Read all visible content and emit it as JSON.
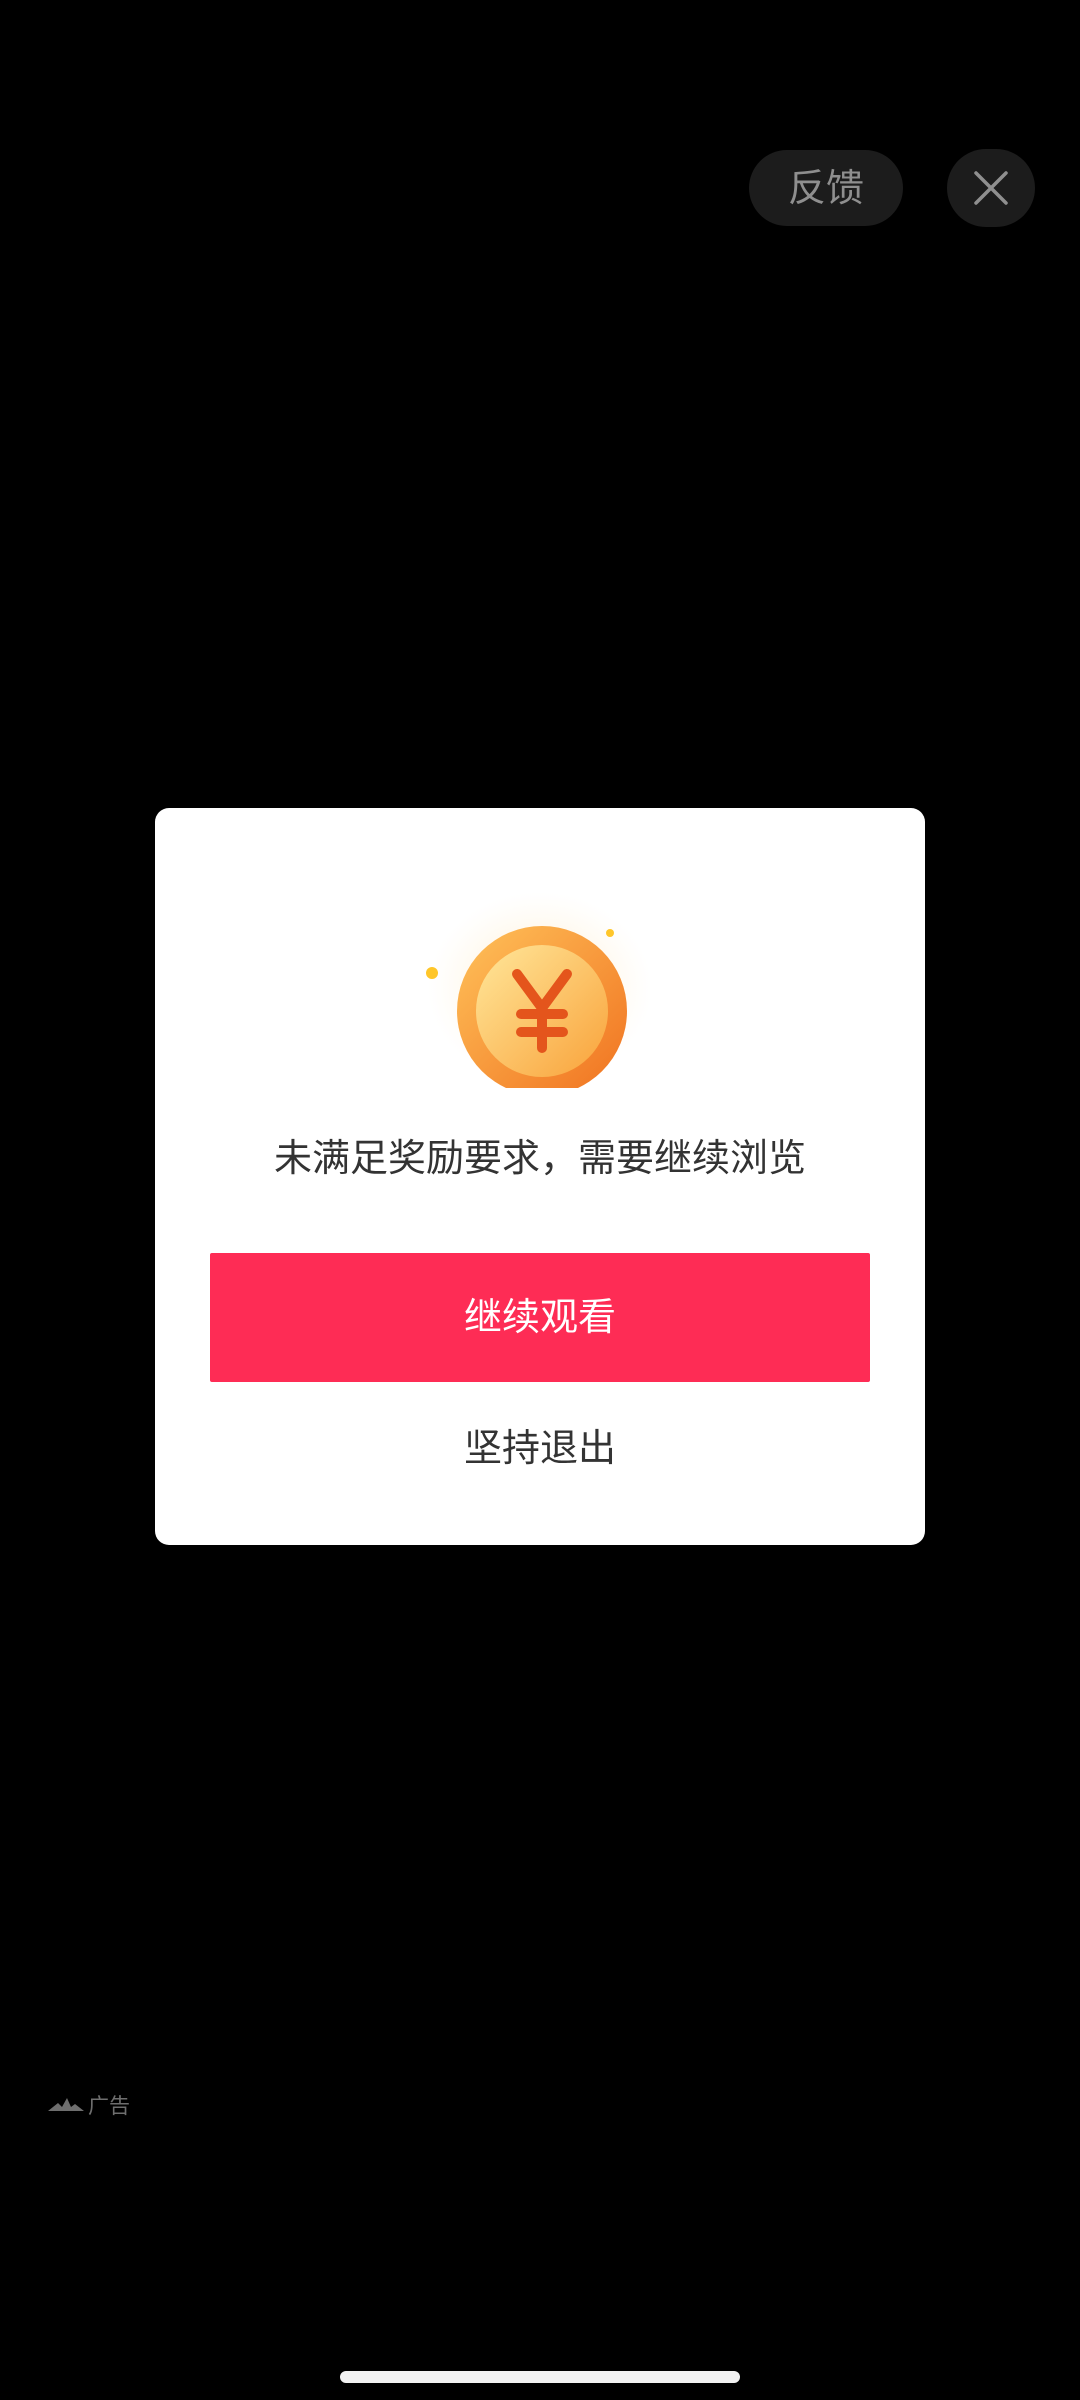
{
  "top_bar": {
    "feedback_label": "反馈",
    "close_icon": "close-icon"
  },
  "dialog": {
    "icon": "yuan-coin-icon",
    "message": "未满足奖励要求，需要继续浏览",
    "primary_label": "继续观看",
    "secondary_label": "坚持退出"
  },
  "ad_tag": {
    "icon": "ad-logo-icon",
    "label": "广告"
  },
  "colors": {
    "background": "#000000",
    "accent": "#fe2c55",
    "dialog_background": "#ffffff",
    "coin_orange": "#f7892a"
  }
}
